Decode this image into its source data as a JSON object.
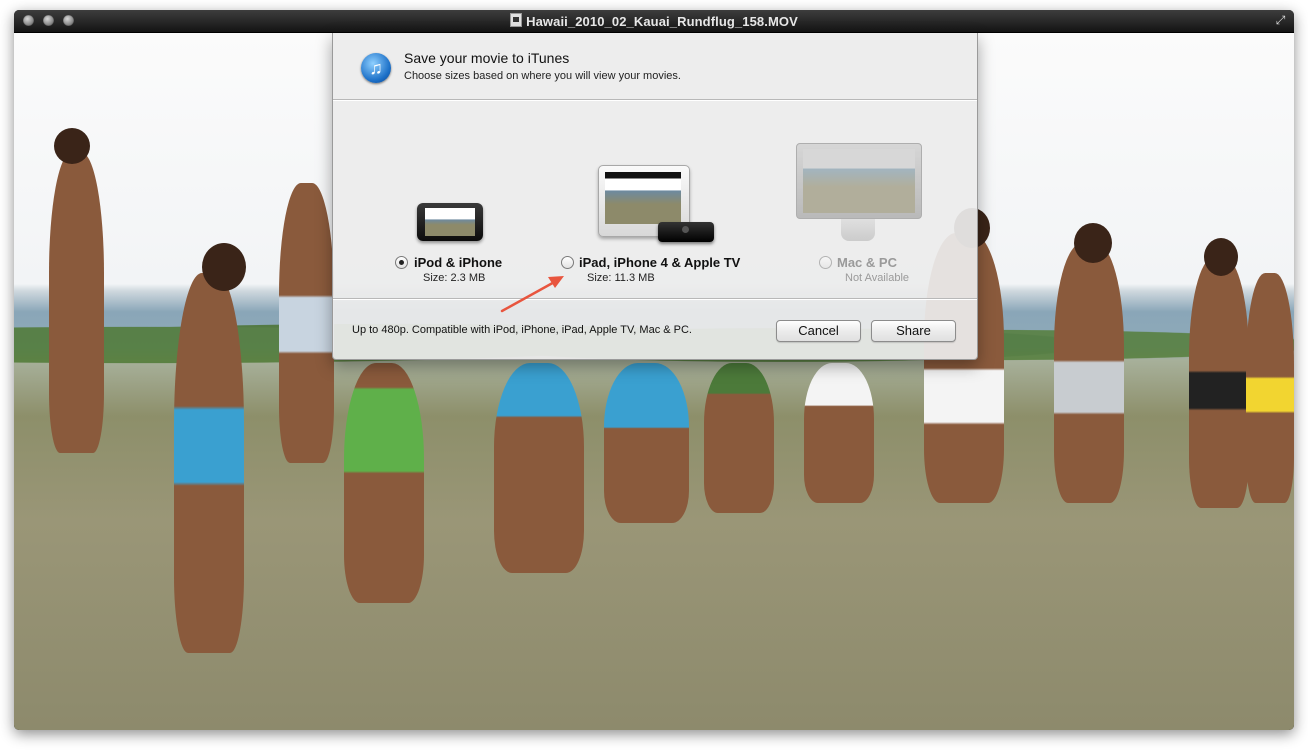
{
  "window": {
    "title": "Hawaii_2010_02_Kauai_Rundflug_158.MOV"
  },
  "dialog": {
    "title": "Save your movie to iTunes",
    "subtitle": "Choose sizes based on where you will view your movies.",
    "options": [
      {
        "label": "iPod & iPhone",
        "detail": "Size: 2.3 MB",
        "selected": true,
        "enabled": true
      },
      {
        "label": "iPad, iPhone 4 & Apple TV",
        "detail": "Size: 11.3 MB",
        "selected": false,
        "enabled": true
      },
      {
        "label": "Mac & PC",
        "detail": "Not Available",
        "selected": false,
        "enabled": false
      }
    ],
    "footer_text": "Up to 480p. Compatible with iPod, iPhone, iPad, Apple TV, Mac & PC.",
    "cancel_label": "Cancel",
    "share_label": "Share"
  },
  "colors": {
    "annotation_arrow": "#e8553e",
    "itunes_blue": "#1b6fc7"
  },
  "icons": [
    "itunes-icon",
    "ipod-iphone-device-icon",
    "ipad-device-icon",
    "apple-tv-device-icon",
    "imac-device-icon",
    "fullscreen-icon",
    "movie-file-icon"
  ]
}
